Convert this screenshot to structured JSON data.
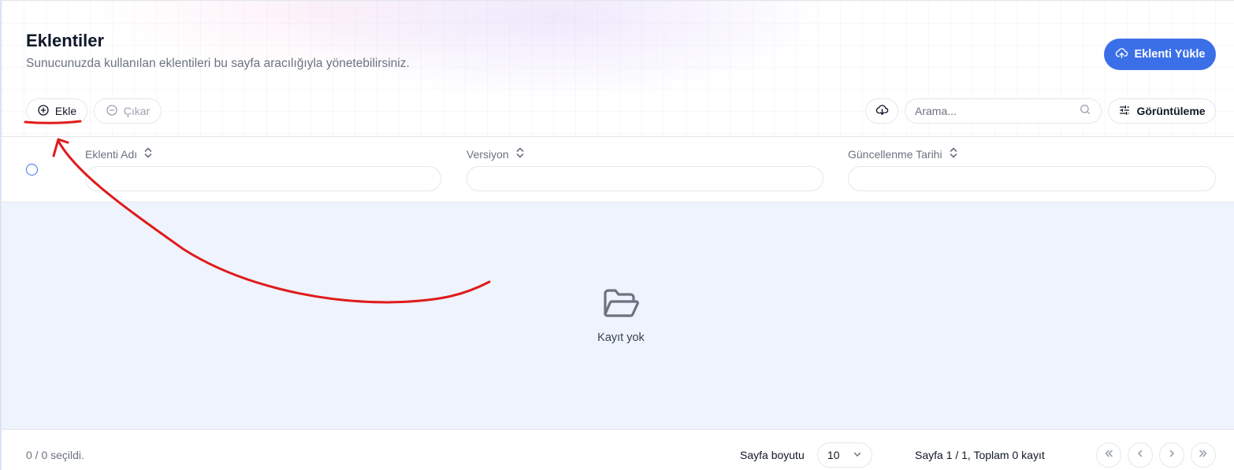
{
  "header": {
    "title": "Eklentiler",
    "subtitle": "Sunucunuzda kullanılan eklentileri bu sayfa aracılığıyla yönetebilirsiniz.",
    "upload_label": "Eklenti Yükle",
    "upload_icon": "cloud-upload-icon"
  },
  "toolbar": {
    "add_label": "Ekle",
    "add_icon": "plus-circle-icon",
    "remove_label": "Çıkar",
    "remove_icon": "minus-circle-icon",
    "download_icon": "cloud-download-icon",
    "search_placeholder": "Arama...",
    "search_value": "",
    "view_label": "Görüntüleme",
    "view_icon": "sliders-icon"
  },
  "table": {
    "columns": [
      {
        "label": "Eklenti Adı"
      },
      {
        "label": "Versiyon"
      },
      {
        "label": "Güncellenme Tarihi"
      }
    ],
    "rows": [],
    "empty_text": "Kayıt yok",
    "empty_icon": "folder-open-icon"
  },
  "footer": {
    "selected_text": "0 / 0 seçildi.",
    "page_size_label": "Sayfa boyutu",
    "page_size_value": "10",
    "page_info": "Sayfa 1 / 1, Toplam 0 kayıt"
  },
  "colors": {
    "accent": "#3b6fe8",
    "empty_bg": "#eef3fd",
    "annotation": "#e01b1b"
  }
}
